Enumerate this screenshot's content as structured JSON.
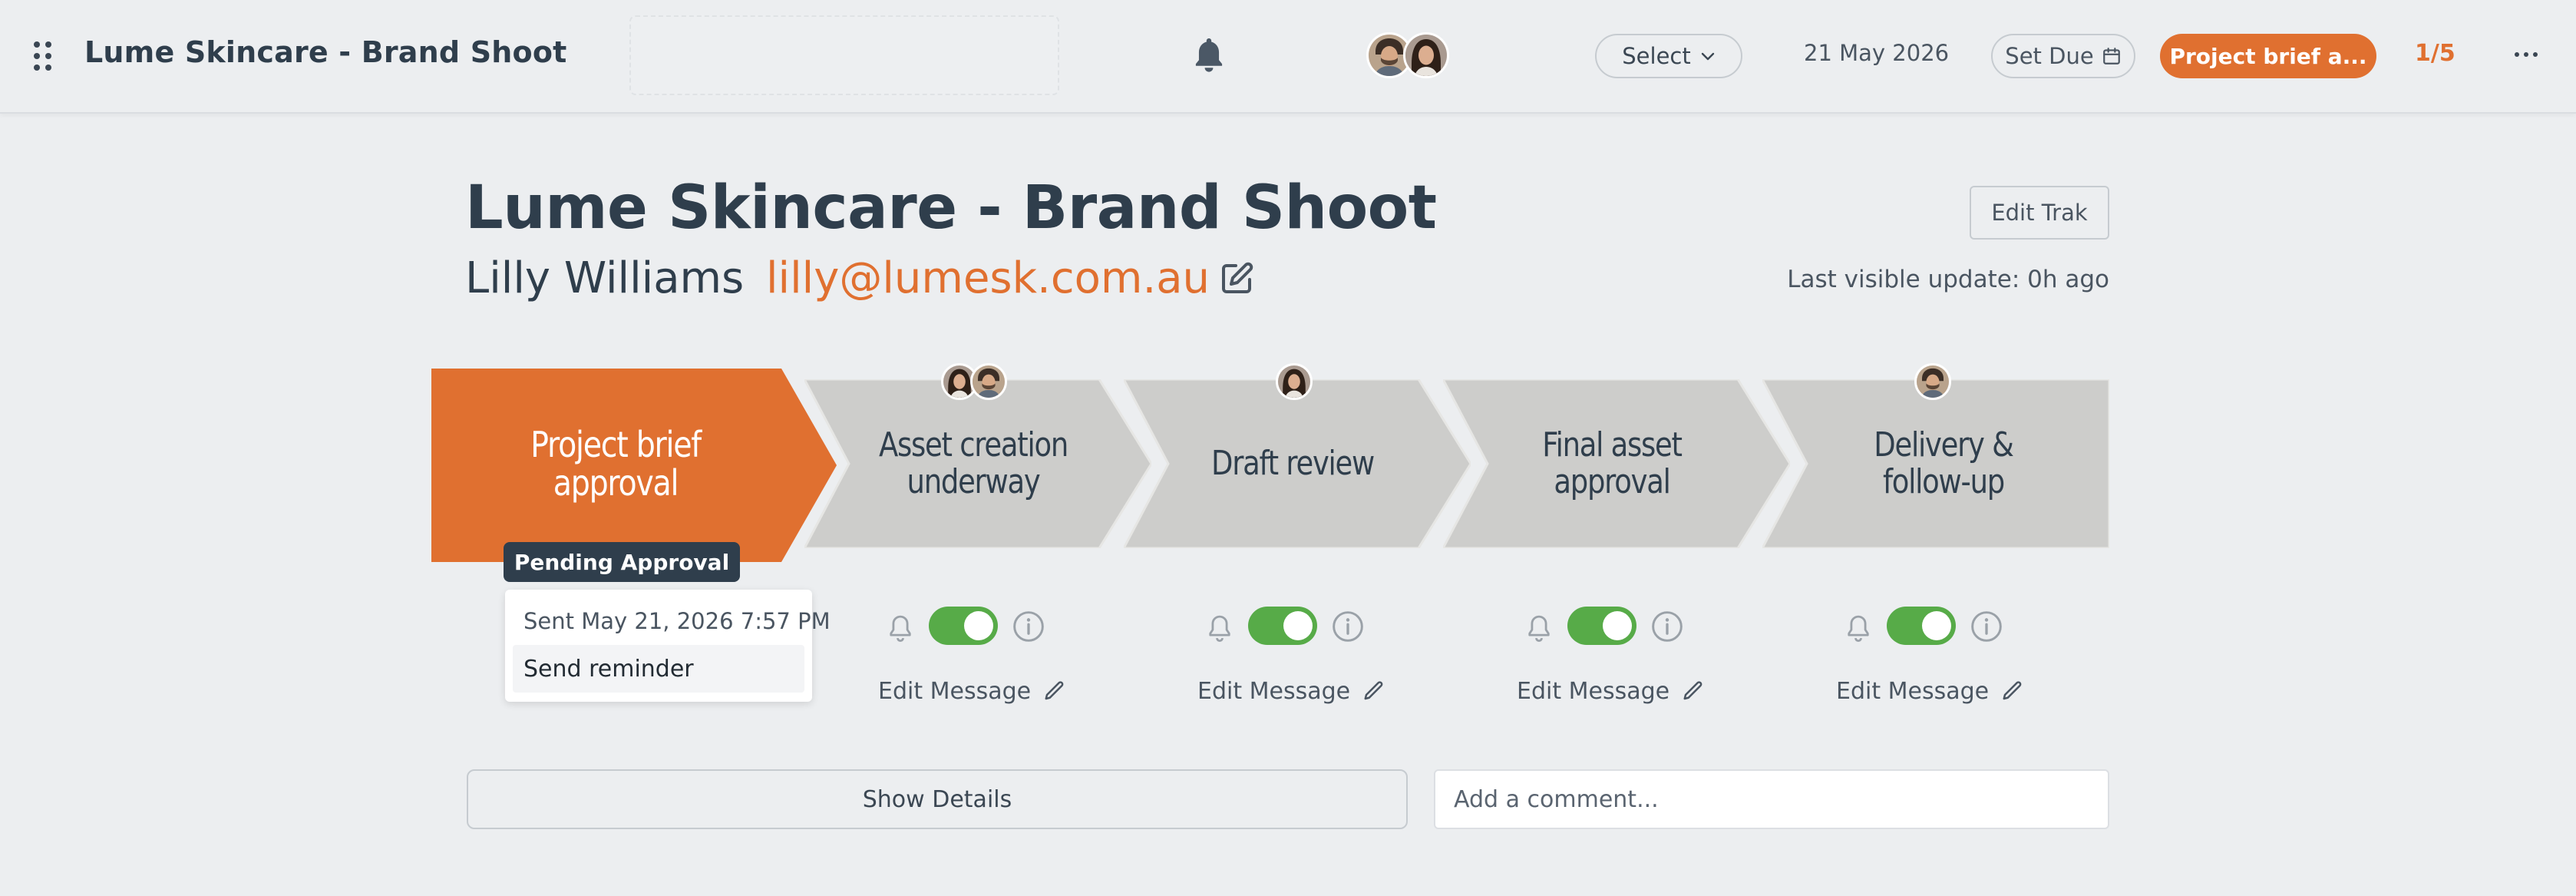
{
  "topbar": {
    "title": "Lume Skincare - Brand Shoot",
    "select_label": "Select",
    "date": "21 May 2026",
    "set_due_label": "Set Due",
    "stage_pill": "Project brief a...",
    "step_counter": "1/5"
  },
  "header": {
    "title": "Lume Skincare - Brand Shoot",
    "client_name": "Lilly Williams",
    "client_email": "lilly@lumesk.com.au",
    "edit_trak_label": "Edit Trak",
    "last_update": "Last visible update: 0h ago"
  },
  "stages": [
    {
      "label": "Project brief approval",
      "status": "active"
    },
    {
      "label": "Asset creation underway",
      "status": "idle"
    },
    {
      "label": "Draft review",
      "status": "idle"
    },
    {
      "label": "Final asset approval",
      "status": "idle"
    },
    {
      "label": "Delivery & follow-up",
      "status": "idle"
    }
  ],
  "active_stage": {
    "badge": "Pending Approval",
    "sent_text": "Sent May 21, 2026 7:57 PM",
    "reminder_label": "Send reminder"
  },
  "controls": {
    "edit_message_label": "Edit Message",
    "toggle_on": true
  },
  "footer": {
    "show_details_label": "Show Details",
    "comment_placeholder": "Add a comment..."
  },
  "colors": {
    "accent": "#e07030",
    "dark": "#2f3e4c",
    "toggle_on": "#57ab48",
    "stage_idle": "#cdcdcb"
  }
}
